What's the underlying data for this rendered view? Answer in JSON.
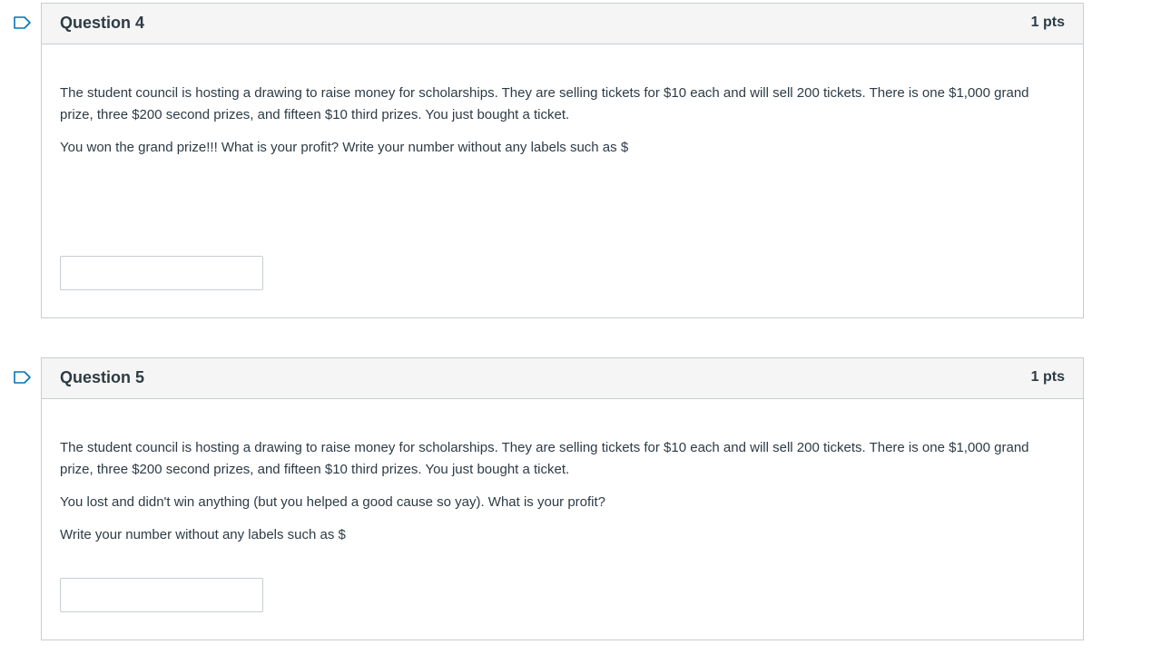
{
  "questions": [
    {
      "title": "Question 4",
      "points": "1 pts",
      "paragraphs": [
        "The student council is hosting a drawing to raise money for scholarships. They are selling tickets for $10 each and will sell 200 tickets. There is one $1,000 grand prize, three $200 second prizes, and fifteen $10 third prizes. You just bought a ticket.",
        "You won the grand prize!!! What is your profit? Write your number without any labels such as $"
      ],
      "answer_value": ""
    },
    {
      "title": "Question 5",
      "points": "1 pts",
      "paragraphs": [
        "The student council is hosting a drawing to raise money for scholarships. They are selling tickets for $10 each and will sell 200 tickets. There is one $1,000 grand prize, three $200 second prizes, and fifteen $10 third prizes. You just bought a ticket.",
        "You lost and didn't win anything (but you helped a good cause so yay).  What is your profit?",
        "Write your number without any labels such as $"
      ],
      "answer_value": ""
    }
  ],
  "colors": {
    "border": "#c7cdd1",
    "header_bg": "#f5f5f5",
    "text": "#2d3b45",
    "flag_stroke": "#0374b5"
  },
  "icons": {
    "flag": "flag-icon"
  }
}
